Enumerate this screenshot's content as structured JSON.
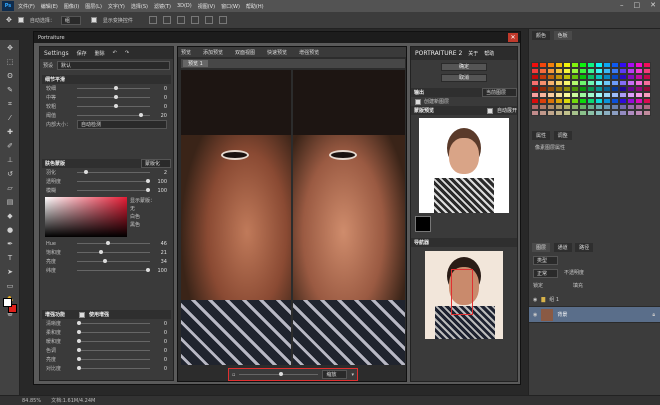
{
  "app": {
    "logo": "Ps",
    "menus": [
      "文件(F)",
      "编辑(E)",
      "图像(I)",
      "图层(L)",
      "文字(Y)",
      "选择(S)",
      "滤镜(T)",
      "3D(D)",
      "视图(V)",
      "窗口(W)",
      "帮助(H)"
    ]
  },
  "options": {
    "auto_select": "自动选择：",
    "group_select": "组",
    "show_transform": "显示变换控件"
  },
  "dialog": {
    "title": "Portraiture"
  },
  "left": {
    "settings": "Settings",
    "save": "保存",
    "delete": "删除",
    "preset_label": "预设",
    "preset_value": "默认",
    "detail": {
      "title": "细节平滑",
      "rows": [
        {
          "label": "较细",
          "value": "0",
          "pos": 0.5
        },
        {
          "label": "中等",
          "value": "0",
          "pos": 0.5
        },
        {
          "label": "较粗",
          "value": "0",
          "pos": 0.5
        },
        {
          "label": "阈值",
          "value": "20",
          "pos": 0.85
        }
      ],
      "size_label": "内部大小：",
      "size_value": "自动检测"
    },
    "mask": {
      "title": "肤色蒙版",
      "mode": "蒙版化",
      "show_label": "显示蒙版：",
      "opts": [
        "无",
        "白色",
        "黑色"
      ],
      "rows": [
        {
          "label": "羽化",
          "value": "2",
          "pos": 0.1
        },
        {
          "label": "透明度",
          "value": "100",
          "pos": 0.95
        },
        {
          "label": "模糊",
          "value": "100",
          "pos": 0.95
        }
      ],
      "rows2": [
        {
          "label": "Hue",
          "value": "46",
          "pos": 0.4
        },
        {
          "label": "饱和度",
          "value": "21",
          "pos": 0.3
        },
        {
          "label": "亮度",
          "value": "34",
          "pos": 0.35
        },
        {
          "label": "纬度",
          "value": "100",
          "pos": 0.95
        }
      ]
    },
    "enh": {
      "title": "增强功能",
      "use": "使用增强",
      "rows": [
        {
          "label": "清晰度",
          "value": "0",
          "pos": 0.0
        },
        {
          "label": "柔和度",
          "value": "0",
          "pos": 0.0
        },
        {
          "label": "暖和度",
          "value": "0",
          "pos": 0.0
        },
        {
          "label": "色调",
          "value": "0",
          "pos": 0.0
        },
        {
          "label": "亮度",
          "value": "0",
          "pos": 0.0
        },
        {
          "label": "对比度",
          "value": "0",
          "pos": 0.0
        }
      ]
    }
  },
  "canvas": {
    "preview": "预览",
    "labels": [
      "添加预览",
      "双面视图",
      "快速预览",
      "增强预览"
    ],
    "tab": "预览 1",
    "zoom": "缩放"
  },
  "right": {
    "brand": "PORTRAITURE 2",
    "about": "关于",
    "help": "帮助",
    "ok": "确定",
    "cancel": "取消",
    "output": "输出",
    "output_val": "当前图层",
    "create_layer": "创建新图层",
    "mask_preview": "蒙版预览",
    "auto_expand": "自动展开",
    "navigator": "导航器"
  },
  "dock": {
    "tabs1": [
      "颜色",
      "色板"
    ],
    "tabs2": [
      "属性",
      "调整"
    ],
    "props_label": "像素图层属性",
    "tabs3": [
      "图层",
      "通道",
      "路径"
    ],
    "kind": "类型",
    "normal": "正常",
    "opacity_label": "不透明度",
    "lock": "锁定",
    "fill_label": "填充",
    "group": "组 1",
    "bg": "背景"
  },
  "status": {
    "zoom": "84.85%",
    "doc": "文档:1.61M/4.24M"
  },
  "colors": {
    "accent": "#e03030"
  }
}
